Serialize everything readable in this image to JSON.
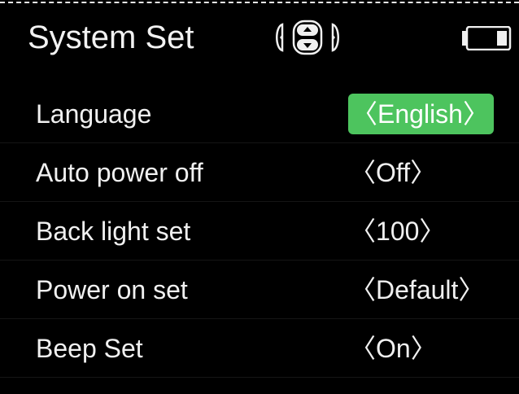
{
  "header": {
    "title": "System Set",
    "nav_icon": "four-way-dpad-icon",
    "battery_icon": "battery-icon"
  },
  "settings": [
    {
      "label": "Language",
      "value": "English",
      "selected": true
    },
    {
      "label": "Auto power off",
      "value": "Off",
      "selected": false
    },
    {
      "label": "Back light set",
      "value": "100",
      "selected": false
    },
    {
      "label": "Power on set",
      "value": "Default",
      "selected": false
    },
    {
      "label": "Beep Set",
      "value": "On",
      "selected": false
    }
  ],
  "value_brackets": {
    "left": "〈",
    "right": "〉"
  },
  "colors": {
    "background": "#000000",
    "text": "#f0f0f0",
    "selected_highlight": "#4dc45e"
  }
}
